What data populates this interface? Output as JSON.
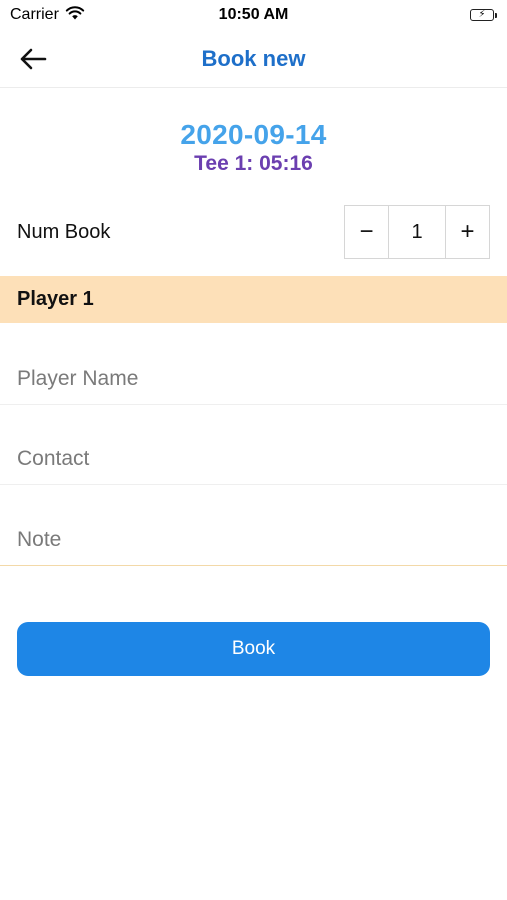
{
  "status_bar": {
    "carrier": "Carrier",
    "time": "10:50 AM",
    "wifi_icon": "wifi-icon",
    "battery_icon": "battery-charging-icon",
    "battery_color": "#34c759"
  },
  "nav": {
    "back_icon": "arrow-left-icon",
    "title": "Book new",
    "title_color": "#1e6fc9"
  },
  "booking": {
    "date": "2020-09-14",
    "tee": "Tee 1: 05:16",
    "date_color": "#45a3ea",
    "tee_color": "#6b3fb0"
  },
  "num_book": {
    "label": "Num Book",
    "decrement_label": "−",
    "value": "1",
    "increment_label": "+"
  },
  "player_section": {
    "title": "Player 1",
    "background": "#fde0b8"
  },
  "fields": {
    "player_name": {
      "placeholder": "Player Name",
      "value": ""
    },
    "contact": {
      "placeholder": "Contact",
      "value": ""
    },
    "note": {
      "placeholder": "Note",
      "value": ""
    }
  },
  "book_button": {
    "label": "Book",
    "color": "#1e86e6"
  }
}
